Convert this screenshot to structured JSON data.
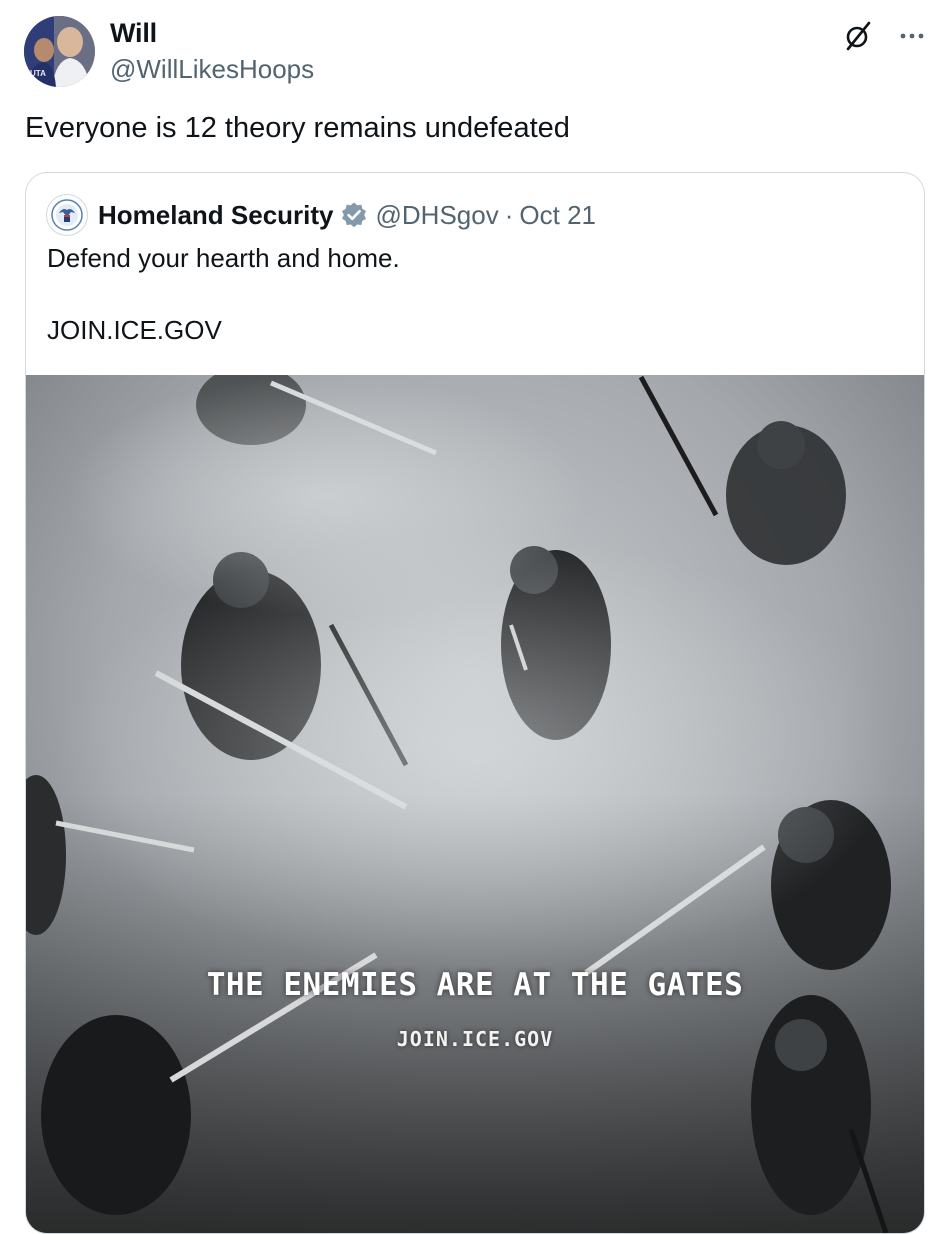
{
  "author": {
    "display_name": "Will",
    "handle": "@WillLikesHoops",
    "avatar_icon": "avatar-photo"
  },
  "post": {
    "text": "Everyone is 12 theory remains undefeated"
  },
  "actions": {
    "grok_icon": "grok-icon",
    "more_icon": "more-icon"
  },
  "quoted": {
    "display_name": "Homeland Security",
    "verified_icon": "verified-badge-icon",
    "handle": "@DHSgov",
    "separator": "·",
    "date": "Oct 21",
    "line1": "Defend your hearth and home.",
    "line2": "JOIN.ICE.GOV",
    "media": {
      "headline": "THE ENEMIES ARE AT THE GATES",
      "subline": "JOIN.ICE.GOV"
    }
  },
  "colors": {
    "text_primary": "#0f1419",
    "text_secondary": "#536471",
    "border": "#cfd9de",
    "verified_gray": "#829aab"
  }
}
